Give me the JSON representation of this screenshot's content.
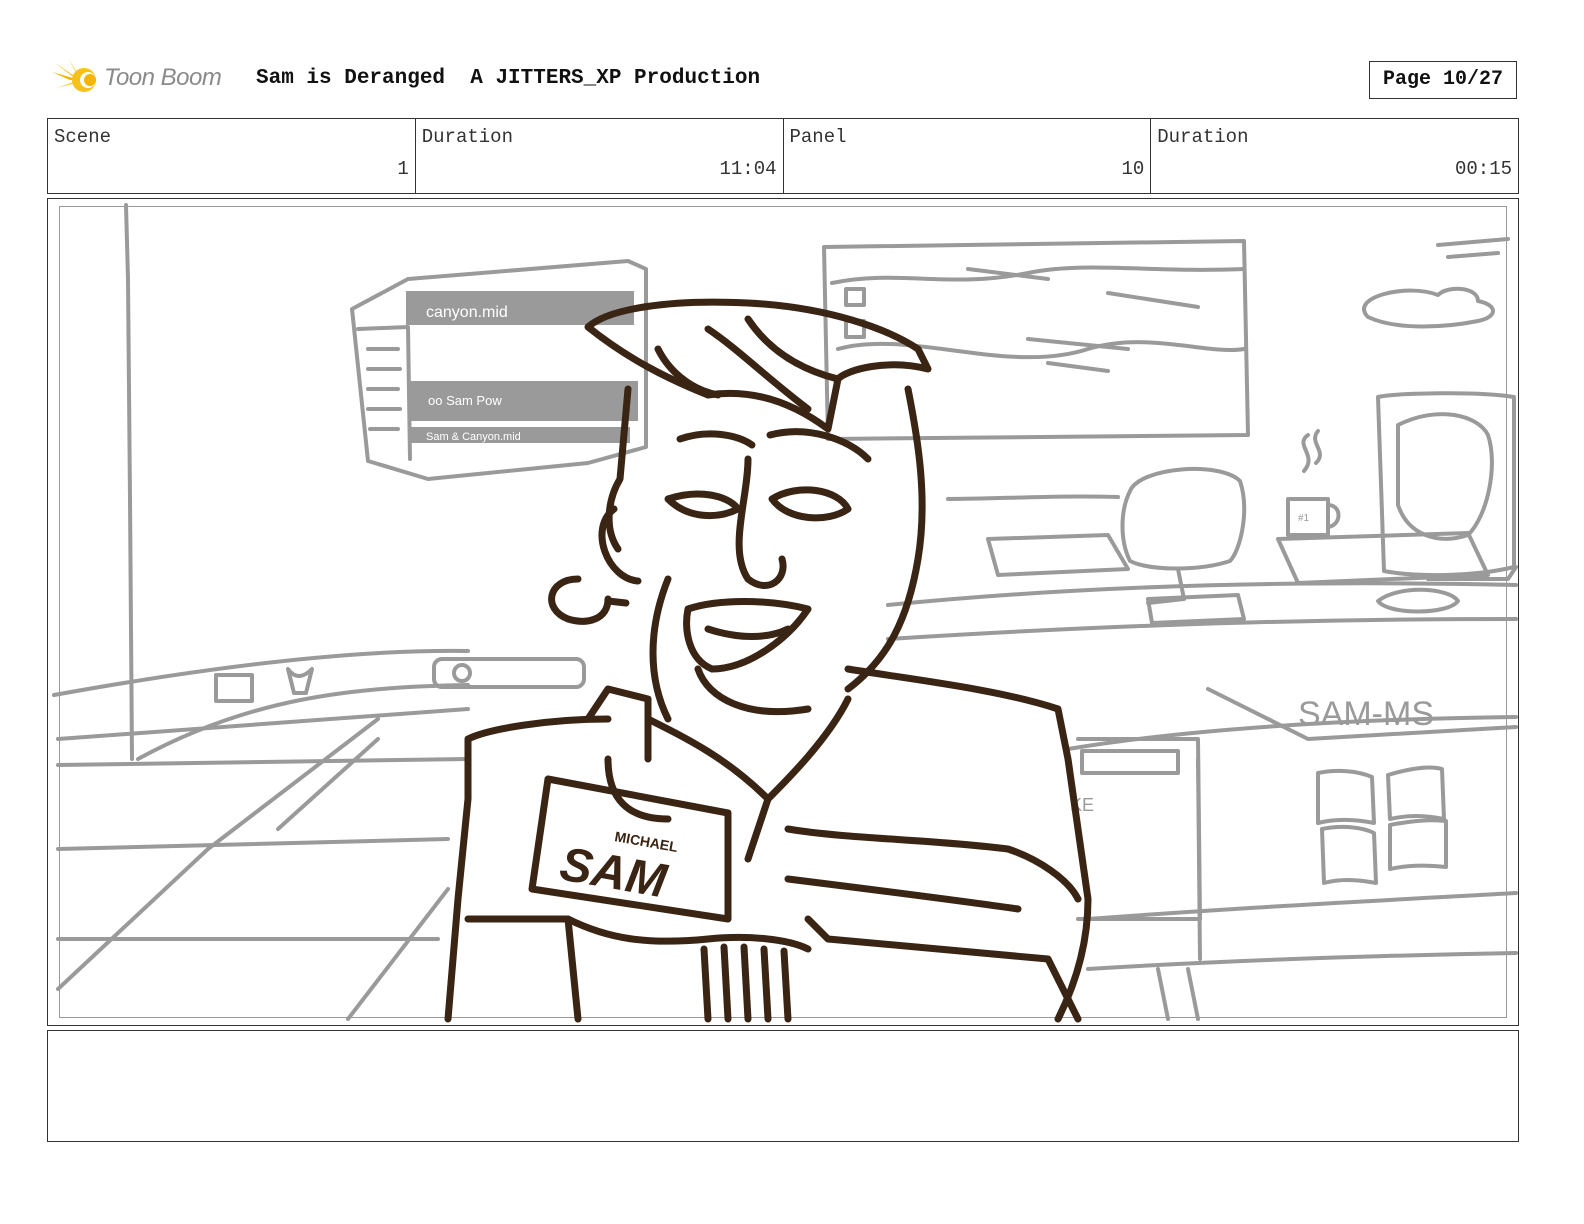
{
  "header": {
    "logo_text": "Toon Boom",
    "title": "Sam is Deranged  A JITTERS_XP Production",
    "page_label": "Page 10/27"
  },
  "info": {
    "scene_label": "Scene",
    "scene_value": "1",
    "scene_duration_label": "Duration",
    "scene_duration_value": "11:04",
    "panel_label": "Panel",
    "panel_value": "10",
    "panel_duration_label": "Duration",
    "panel_duration_value": "00:15"
  },
  "panel": {
    "sketch_labels": {
      "window_title": "canyon.mid",
      "window_status": "oo Sam Pow",
      "window_footer": "Sam & Canyon.mid",
      "desk_sign": "SAM-MS",
      "name_tag_small": "MICHAEL",
      "name_tag_large": "SAM",
      "mug_text": "#1",
      "panel_text": "KE"
    },
    "colors": {
      "sketch_gray": "#9a9a9a",
      "ink_brown": "#3a2414"
    }
  },
  "notes": {
    "text": ""
  }
}
